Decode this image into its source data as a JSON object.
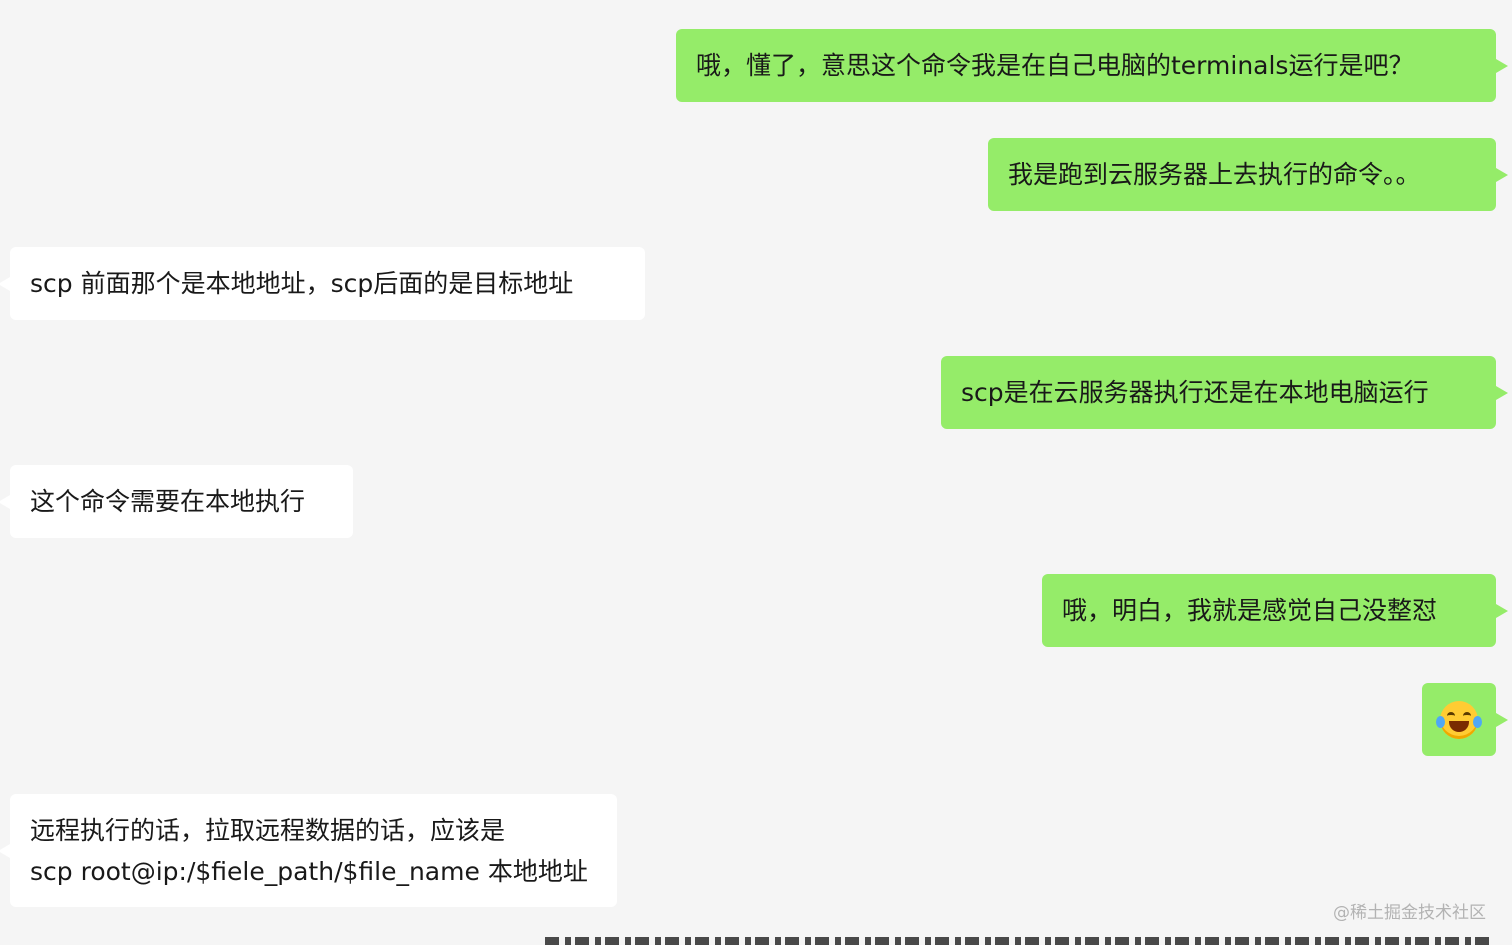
{
  "messages": [
    {
      "id": "m1",
      "side": "right",
      "text": "哦，懂了，意思这个命令我是在自己电脑的terminals运行是吧？"
    },
    {
      "id": "m2",
      "side": "right",
      "text": "我是跑到云服务器上去执行的命令。。"
    },
    {
      "id": "m3",
      "side": "left",
      "text": "scp 前面那个是本地地址，scp后面的是目标地址"
    },
    {
      "id": "m4",
      "side": "right",
      "text": "scp是在云服务器执行还是在本地电脑运行"
    },
    {
      "id": "m5",
      "side": "left",
      "text": "这个命令需要在本地执行"
    },
    {
      "id": "m6",
      "side": "right",
      "text": "哦，明白，我就是感觉自己没整怼"
    },
    {
      "id": "m7",
      "side": "right",
      "icon": "tears-of-joy-emoji-icon"
    },
    {
      "id": "m8",
      "side": "left",
      "lines": [
        "远程执行的话，拉取远程数据的话，应该是",
        "scp root@ip:/$fiele_path/$file_name 本地地址"
      ]
    }
  ],
  "watermark": "@稀土掘金技术社区",
  "colors": {
    "background": "#f5f5f5",
    "sent_bubble": "#95ec69",
    "received_bubble": "#ffffff"
  }
}
